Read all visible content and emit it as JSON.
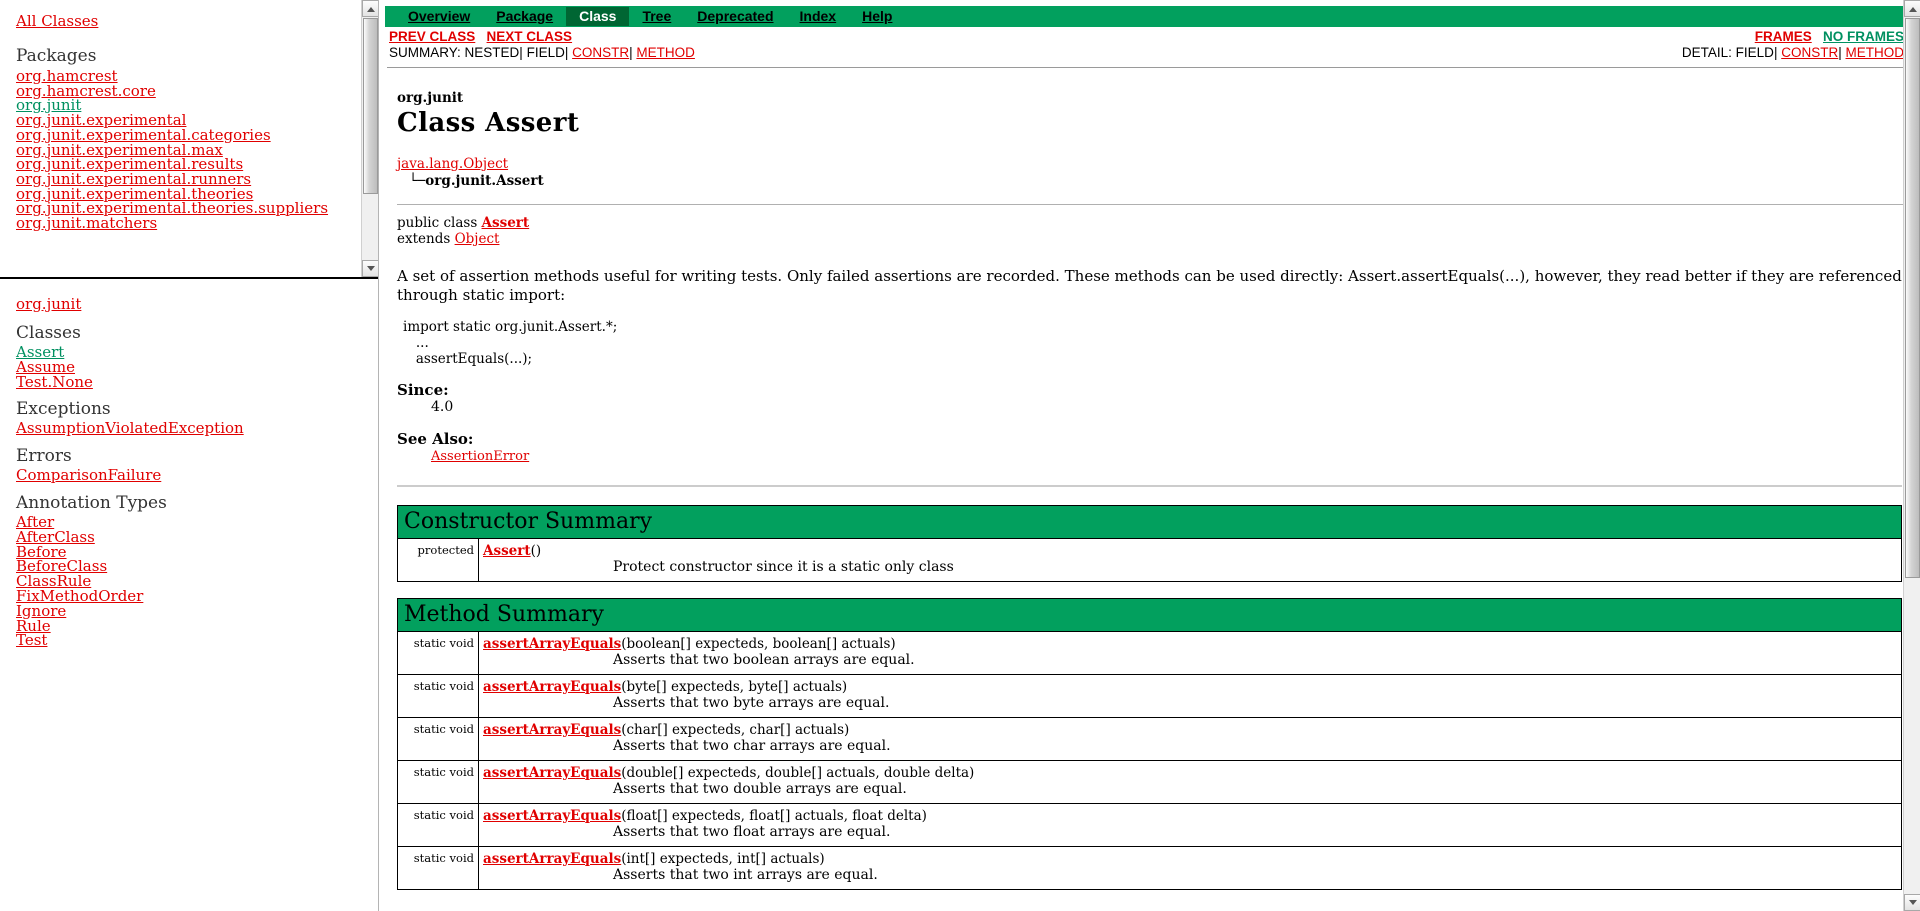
{
  "colors": {
    "nav_bg": "#02a05e",
    "nav_active_bg": "#006633",
    "link": "#e00000",
    "link_visited": "#009060",
    "table_header_bg": "#02a05e"
  },
  "package_frame": {
    "all_classes_label": "All Classes",
    "heading": "Packages",
    "packages": [
      {
        "label": "org.hamcrest",
        "state": "link"
      },
      {
        "label": "org.hamcrest.core",
        "state": "link"
      },
      {
        "label": "org.junit",
        "state": "visited"
      },
      {
        "label": "org.junit.experimental",
        "state": "link"
      },
      {
        "label": "org.junit.experimental.categories",
        "state": "link"
      },
      {
        "label": "org.junit.experimental.max",
        "state": "link"
      },
      {
        "label": "org.junit.experimental.results",
        "state": "link"
      },
      {
        "label": "org.junit.experimental.runners",
        "state": "link"
      },
      {
        "label": "org.junit.experimental.theories",
        "state": "link"
      },
      {
        "label": "org.junit.experimental.theories.suppliers",
        "state": "link"
      },
      {
        "label": "org.junit.matchers",
        "state": "link"
      }
    ]
  },
  "class_frame": {
    "package_link": "org.junit",
    "groups": [
      {
        "heading": "Classes",
        "items": [
          {
            "label": "Assert",
            "state": "visited"
          },
          {
            "label": "Assume",
            "state": "link"
          },
          {
            "label": "Test.None",
            "state": "link"
          }
        ]
      },
      {
        "heading": "Exceptions",
        "items": [
          {
            "label": "AssumptionViolatedException",
            "state": "link"
          }
        ]
      },
      {
        "heading": "Errors",
        "items": [
          {
            "label": "ComparisonFailure",
            "state": "link"
          }
        ]
      },
      {
        "heading": "Annotation Types",
        "items": [
          {
            "label": "After",
            "state": "link"
          },
          {
            "label": "AfterClass",
            "state": "link"
          },
          {
            "label": "Before",
            "state": "link"
          },
          {
            "label": "BeforeClass",
            "state": "link"
          },
          {
            "label": "ClassRule",
            "state": "link"
          },
          {
            "label": "FixMethodOrder",
            "state": "link"
          },
          {
            "label": "Ignore",
            "state": "link"
          },
          {
            "label": "Rule",
            "state": "link"
          },
          {
            "label": "Test",
            "state": "link"
          }
        ]
      }
    ]
  },
  "navbar": {
    "items": [
      {
        "label": "Overview",
        "active": false
      },
      {
        "label": "Package",
        "active": false
      },
      {
        "label": "Class",
        "active": true
      },
      {
        "label": "Tree",
        "active": false
      },
      {
        "label": "Deprecated",
        "active": false
      },
      {
        "label": "Index",
        "active": false
      },
      {
        "label": "Help",
        "active": false
      }
    ]
  },
  "subnav": {
    "prev_class": "PREV CLASS",
    "next_class": "NEXT CLASS",
    "frames": "FRAMES",
    "no_frames": "NO FRAMES",
    "summary_label": "SUMMARY:",
    "summary_nested": "NESTED",
    "summary_field": "FIELD",
    "summary_constr": "CONSTR",
    "summary_method": "METHOD",
    "detail_label": "DETAIL:",
    "detail_field": "FIELD",
    "detail_constr": "CONSTR",
    "detail_method": "METHOD",
    "sep": "|"
  },
  "class_header": {
    "package": "org.junit",
    "title": "Class Assert",
    "superclass_link": "java.lang.Object",
    "tree_glyph": "└─",
    "tree_self": "org.junit.Assert"
  },
  "declaration": {
    "line1_prefix": "public class ",
    "line1_name": "Assert",
    "line2_prefix": "extends ",
    "line2_link": "Object"
  },
  "description": {
    "text": "A set of assertion methods useful for writing tests. Only failed assertions are recorded. These methods can be used directly: Assert.assertEquals(...), however, they read better if they are referenced through static import:",
    "code": "import static org.junit.Assert.*;\n   ...\n   assertEquals(...);",
    "since_label": "Since:",
    "since_value": "4.0",
    "see_also_label": "See Also:",
    "see_also_link": "AssertionError"
  },
  "constructor_summary": {
    "caption": "Constructor Summary",
    "rows": [
      {
        "modifier": "protected",
        "name": "Assert",
        "params": "()",
        "description": "Protect constructor since it is a static only class"
      }
    ]
  },
  "method_summary": {
    "caption": "Method Summary",
    "rows": [
      {
        "modifier": "static void",
        "name": "assertArrayEquals",
        "params": "(boolean[] expecteds, boolean[] actuals)",
        "description": "Asserts that two boolean arrays are equal."
      },
      {
        "modifier": "static void",
        "name": "assertArrayEquals",
        "params": "(byte[] expecteds, byte[] actuals)",
        "description": "Asserts that two byte arrays are equal."
      },
      {
        "modifier": "static void",
        "name": "assertArrayEquals",
        "params": "(char[] expecteds, char[] actuals)",
        "description": "Asserts that two char arrays are equal."
      },
      {
        "modifier": "static void",
        "name": "assertArrayEquals",
        "params": "(double[] expecteds, double[] actuals, double delta)",
        "description": "Asserts that two double arrays are equal."
      },
      {
        "modifier": "static void",
        "name": "assertArrayEquals",
        "params": "(float[] expecteds, float[] actuals, float delta)",
        "description": "Asserts that two float arrays are equal."
      },
      {
        "modifier": "static void",
        "name": "assertArrayEquals",
        "params": "(int[] expecteds, int[] actuals)",
        "description": "Asserts that two int arrays are equal."
      }
    ]
  }
}
